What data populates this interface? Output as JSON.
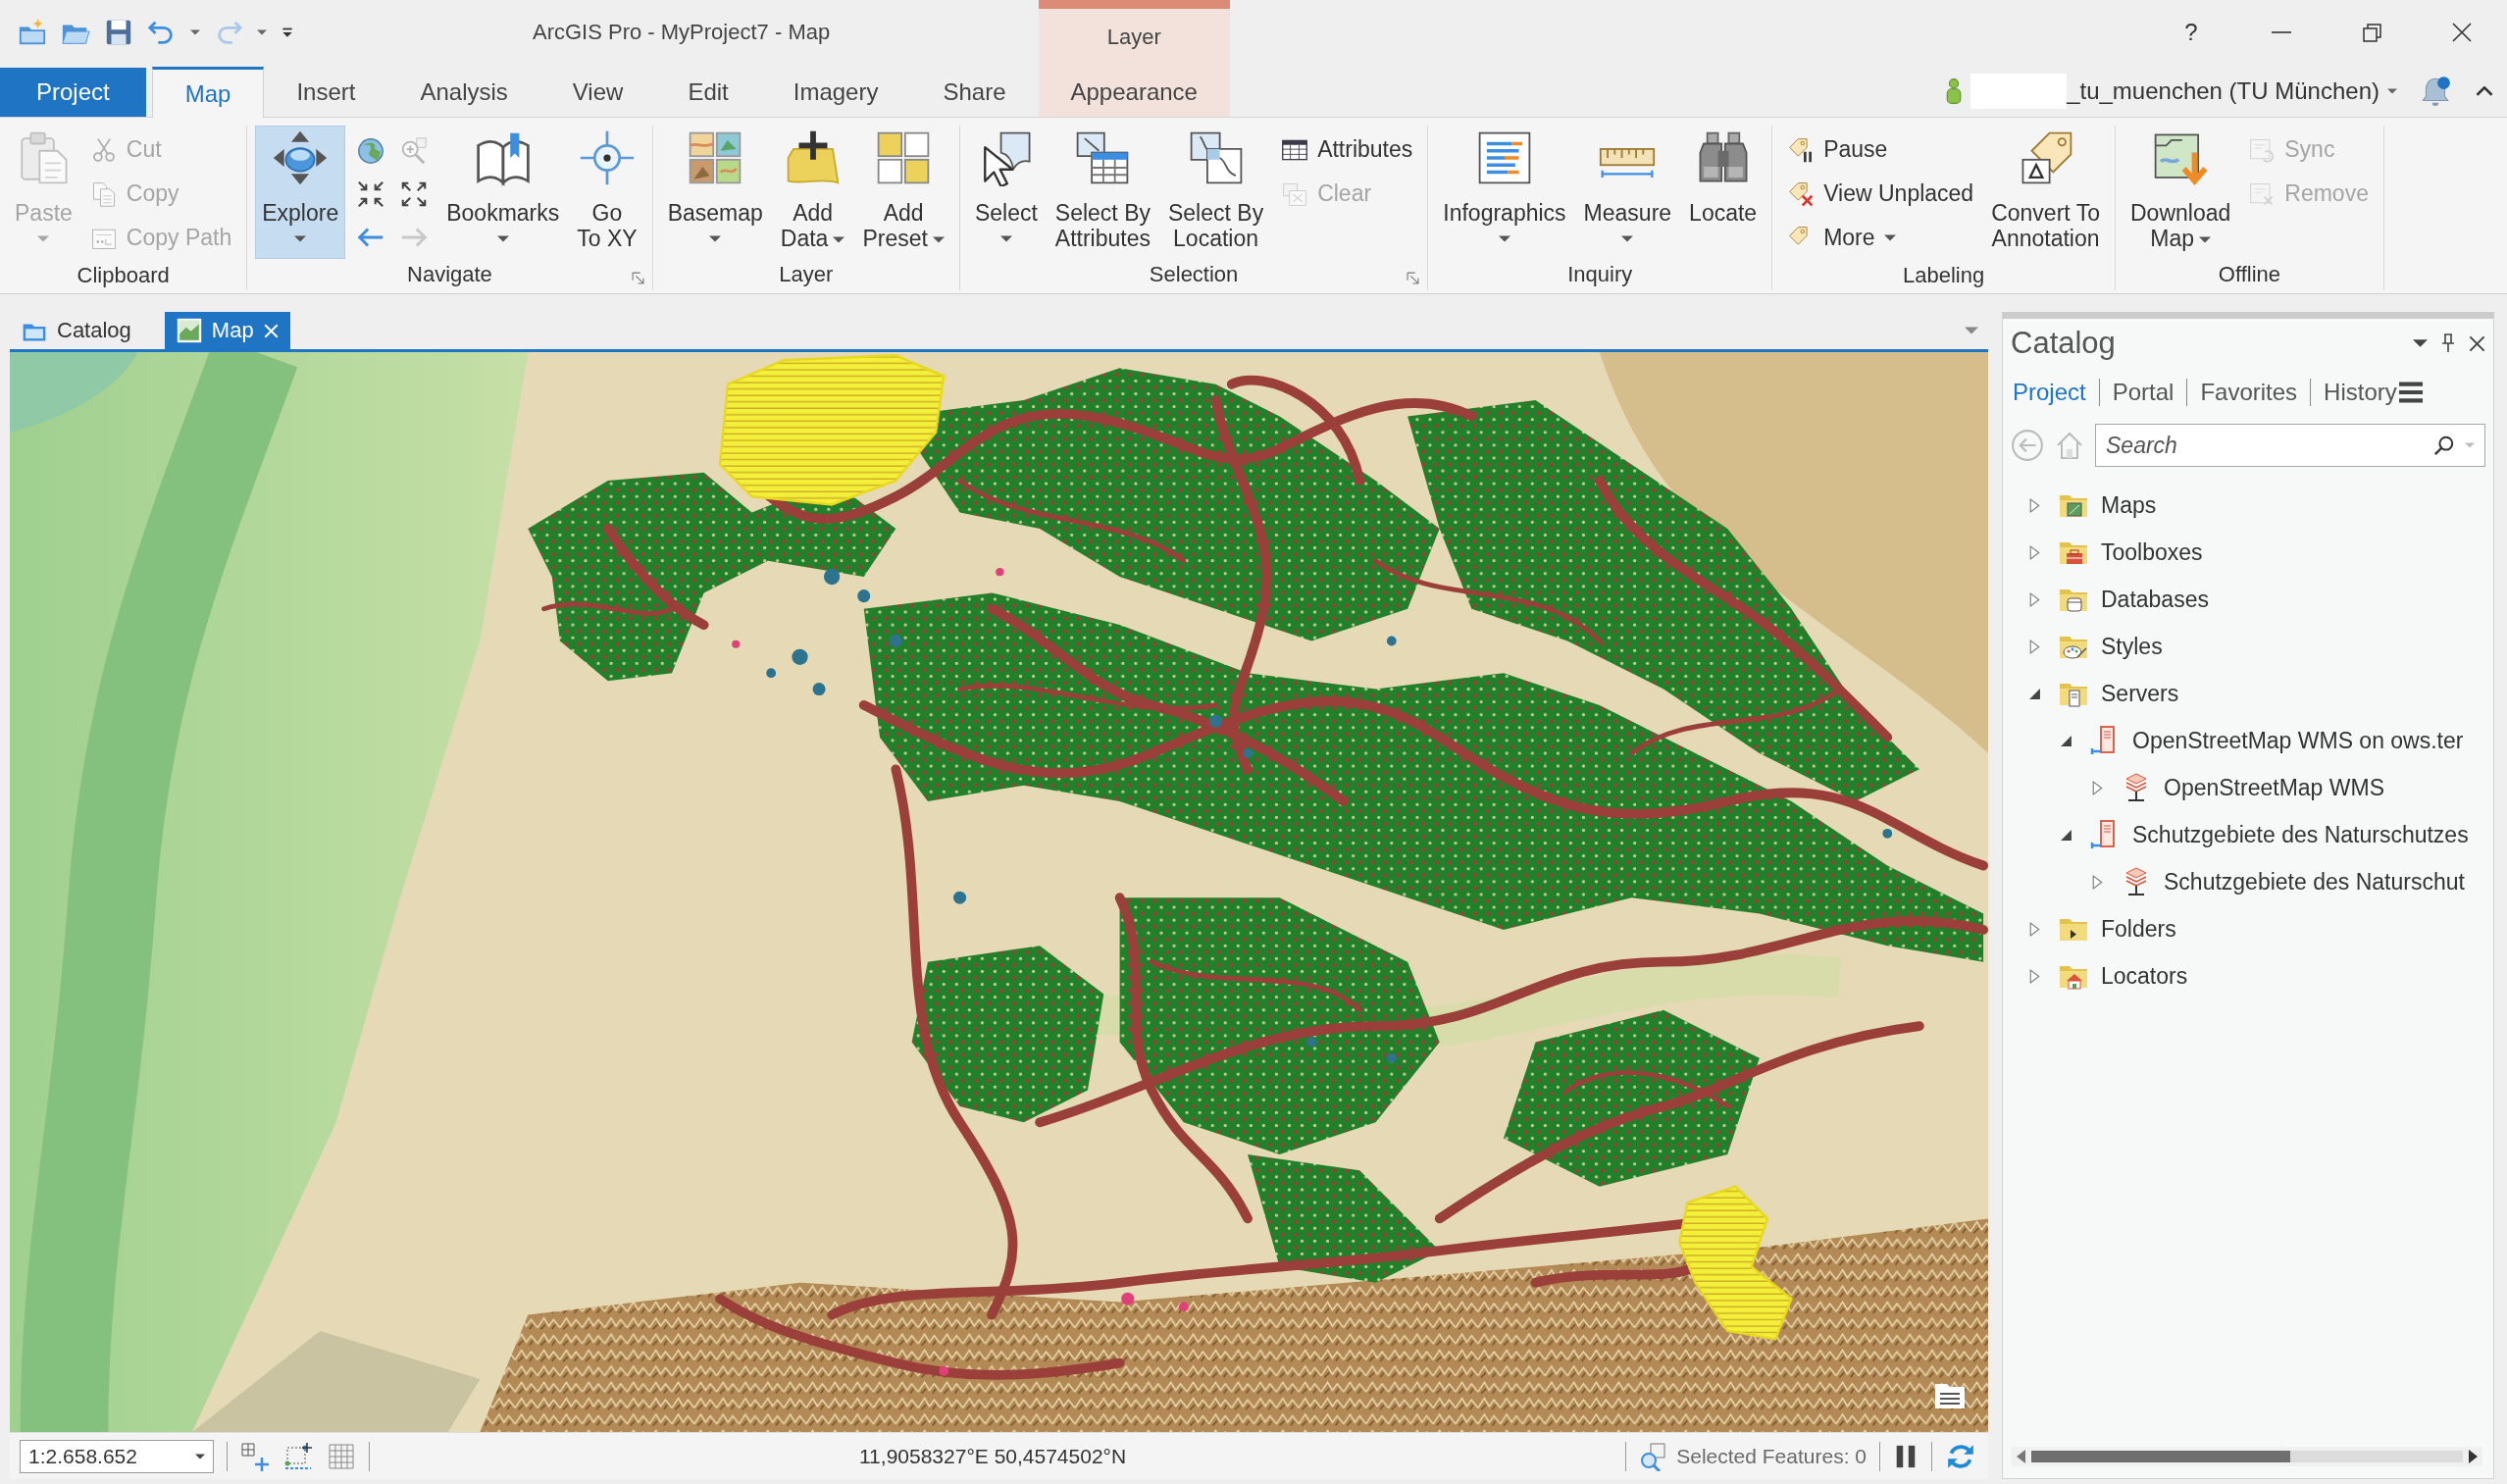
{
  "window": {
    "title": "ArcGIS Pro - MyProject7 - Map",
    "contextual_group": "Layer",
    "help": "?"
  },
  "ribbon_tabs": [
    {
      "label": "Project",
      "kind": "backstage",
      "selected": false
    },
    {
      "label": "Map",
      "kind": "core",
      "selected": true
    },
    {
      "label": "Insert",
      "kind": "core",
      "selected": false
    },
    {
      "label": "Analysis",
      "kind": "core",
      "selected": false
    },
    {
      "label": "View",
      "kind": "core",
      "selected": false
    },
    {
      "label": "Edit",
      "kind": "core",
      "selected": false
    },
    {
      "label": "Imagery",
      "kind": "core",
      "selected": false
    },
    {
      "label": "Share",
      "kind": "core",
      "selected": false
    },
    {
      "label": "Appearance",
      "kind": "contextual",
      "selected": false
    }
  ],
  "account": {
    "name": "_tu_muenchen (TU München)"
  },
  "ribbon_groups": [
    {
      "title": "Clipboard",
      "launcher": false,
      "items": [
        {
          "kind": "large",
          "label": "Paste",
          "dropdown": true,
          "selected": false,
          "disabled": true
        },
        {
          "kind": "stack",
          "tools": [
            {
              "label": "Cut",
              "disabled": true
            },
            {
              "label": "Copy",
              "disabled": true
            },
            {
              "label": "Copy Path",
              "disabled": true
            }
          ]
        }
      ]
    },
    {
      "title": "Navigate",
      "launcher": true,
      "items": [
        {
          "kind": "large",
          "label": "Explore",
          "dropdown": true,
          "selected": true,
          "disabled": false
        },
        {
          "kind": "grid",
          "tools": [
            {
              "disabled": false
            },
            {
              "disabled": true
            },
            {
              "disabled": false
            },
            {
              "disabled": false
            },
            {
              "disabled": false
            },
            {
              "disabled": true
            }
          ]
        },
        {
          "kind": "large",
          "label": "Bookmarks",
          "dropdown": true,
          "selected": false,
          "disabled": false
        },
        {
          "kind": "large",
          "label": "Go\nTo XY",
          "dropdown": false,
          "selected": false,
          "disabled": false
        }
      ]
    },
    {
      "title": "Layer",
      "launcher": false,
      "items": [
        {
          "kind": "large",
          "label": "Basemap",
          "dropdown": true,
          "selected": false,
          "disabled": false
        },
        {
          "kind": "large",
          "label": "Add\nData",
          "dropdown": true,
          "selected": false,
          "disabled": false
        },
        {
          "kind": "large",
          "label": "Add\nPreset",
          "dropdown": true,
          "selected": false,
          "disabled": false
        }
      ]
    },
    {
      "title": "Selection",
      "launcher": true,
      "items": [
        {
          "kind": "large",
          "label": "Select",
          "dropdown": true,
          "selected": false,
          "disabled": false
        },
        {
          "kind": "large",
          "label": "Select By\nAttributes",
          "dropdown": false,
          "selected": false,
          "disabled": false
        },
        {
          "kind": "large",
          "label": "Select By\nLocation",
          "dropdown": false,
          "selected": false,
          "disabled": false
        },
        {
          "kind": "stack",
          "tools": [
            {
              "label": "Attributes",
              "disabled": false
            },
            {
              "label": "Clear",
              "disabled": true
            }
          ]
        }
      ]
    },
    {
      "title": "Inquiry",
      "launcher": false,
      "items": [
        {
          "kind": "large",
          "label": "Infographics",
          "dropdown": true,
          "selected": false,
          "disabled": false
        },
        {
          "kind": "large",
          "label": "Measure",
          "dropdown": true,
          "selected": false,
          "disabled": false
        },
        {
          "kind": "large",
          "label": "Locate",
          "dropdown": false,
          "selected": false,
          "disabled": false
        }
      ]
    },
    {
      "title": "Labeling",
      "launcher": false,
      "items": [
        {
          "kind": "stack",
          "tools": [
            {
              "label": "Pause",
              "disabled": false
            },
            {
              "label": "View Unplaced",
              "disabled": false
            },
            {
              "label": "More",
              "dropdown": true,
              "disabled": false
            }
          ]
        },
        {
          "kind": "large",
          "label": "Convert To\nAnnotation",
          "dropdown": false,
          "selected": false,
          "disabled": false
        }
      ]
    },
    {
      "title": "Offline",
      "launcher": false,
      "items": [
        {
          "kind": "large",
          "label": "Download\nMap",
          "dropdown": true,
          "selected": false,
          "disabled": false
        },
        {
          "kind": "stack",
          "tools": [
            {
              "label": "Sync",
              "disabled": true
            },
            {
              "label": "Remove",
              "disabled": true
            }
          ]
        }
      ]
    }
  ],
  "doc_tabs": [
    {
      "label": "Catalog",
      "selected": false,
      "closable": false
    },
    {
      "label": "Map",
      "selected": true,
      "closable": true
    }
  ],
  "status_bar": {
    "scale": "1:2.658.652",
    "coordinates": "11,9058327°E 50,4574502°N",
    "selected_features": "Selected Features: 0"
  },
  "catalog": {
    "title": "Catalog",
    "tabs": [
      {
        "label": "Project",
        "selected": true
      },
      {
        "label": "Portal",
        "selected": false
      },
      {
        "label": "Favorites",
        "selected": false
      },
      {
        "label": "History",
        "selected": false
      }
    ],
    "search": {
      "placeholder": "Search"
    },
    "tree": [
      {
        "label": "Maps",
        "expanded": false
      },
      {
        "label": "Toolboxes",
        "expanded": false
      },
      {
        "label": "Databases",
        "expanded": false
      },
      {
        "label": "Styles",
        "expanded": false
      },
      {
        "label": "Servers",
        "expanded": true,
        "children": [
          {
            "label": "OpenStreetMap WMS on ows.ter",
            "expanded": true,
            "children": [
              {
                "label": "OpenStreetMap WMS",
                "expanded": false
              }
            ]
          },
          {
            "label": "Schutzgebiete des Naturschutzes",
            "expanded": true,
            "children": [
              {
                "label": "Schutzgebiete des Naturschut",
                "expanded": false
              }
            ]
          }
        ]
      },
      {
        "label": "Folders",
        "expanded": false
      },
      {
        "label": "Locators",
        "expanded": false
      }
    ]
  }
}
